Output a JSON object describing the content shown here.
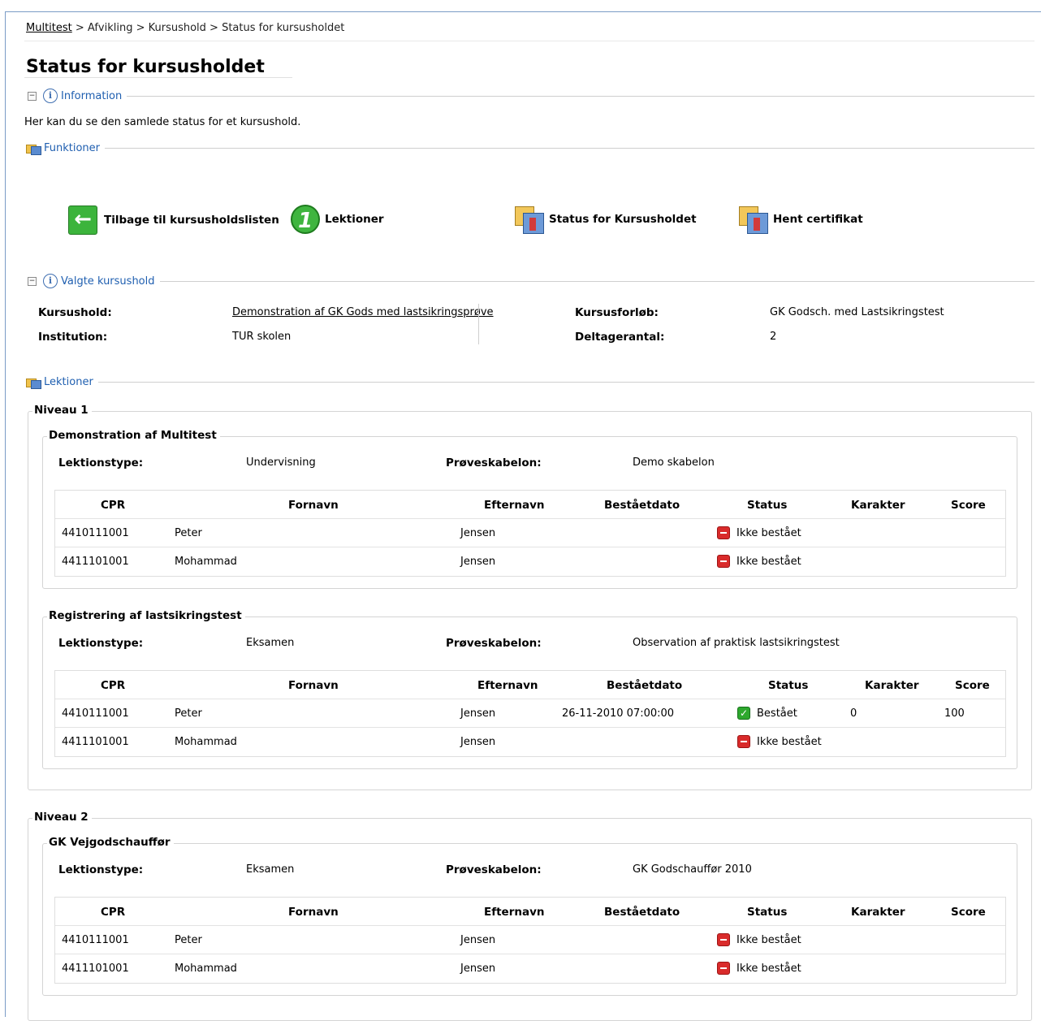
{
  "breadcrumb": {
    "root": "Multitest",
    "path": " > Afvikling > Kursushold > Status for kursusholdet"
  },
  "page_title": "Status for kursusholdet",
  "sections": {
    "information": "Information",
    "functions": "Funktioner",
    "selected": "Valgte kursushold",
    "lessons": "Lektioner"
  },
  "description": "Her kan du se den samlede status for et kursushold.",
  "functions": {
    "back": "Tilbage til kursusholdslisten",
    "lessons": "Lektioner",
    "status": "Status for Kursusholdet",
    "certificate": "Hent certifikat"
  },
  "selected": {
    "kursushold_label": "Kursushold:",
    "kursushold_value": "Demonstration af GK Gods med lastsikringsprøve",
    "institution_label": "Institution:",
    "institution_value": "TUR skolen",
    "forloeb_label": "Kursusforløb:",
    "forloeb_value": "GK Godsch. med Lastsikringstest",
    "deltager_label": "Deltagerantal:",
    "deltager_value": "2"
  },
  "labels": {
    "type": "Lektionstype:",
    "template": "Prøveskabelon:"
  },
  "columns": [
    "CPR",
    "Fornavn",
    "Efternavn",
    "Beståetdato",
    "Status",
    "Karakter",
    "Score"
  ],
  "levels": [
    {
      "name": "Niveau 1",
      "lessons": [
        {
          "name": "Demonstration af Multitest",
          "type": "Undervisning",
          "template": "Demo skabelon",
          "rows": [
            {
              "cpr": "4410111001",
              "first": "Peter",
              "last": "Jensen",
              "date": "",
              "status": "Ikke bestået",
              "grade": "",
              "score": ""
            },
            {
              "cpr": "4411101001",
              "first": "Mohammad",
              "last": "Jensen",
              "date": "",
              "status": "Ikke bestået",
              "grade": "",
              "score": ""
            }
          ]
        },
        {
          "name": "Registrering af lastsikringstest",
          "type": "Eksamen",
          "template": "Observation af praktisk lastsikringstest",
          "rows": [
            {
              "cpr": "4410111001",
              "first": "Peter",
              "last": "Jensen",
              "date": "26-11-2010 07:00:00",
              "status": "Bestået",
              "grade": "0",
              "score": "100"
            },
            {
              "cpr": "4411101001",
              "first": "Mohammad",
              "last": "Jensen",
              "date": "",
              "status": "Ikke bestået",
              "grade": "",
              "score": ""
            }
          ]
        }
      ]
    },
    {
      "name": "Niveau 2",
      "lessons": [
        {
          "name": "GK Vejgodschauffør",
          "type": "Eksamen",
          "template": "GK Godschauffør 2010",
          "rows": [
            {
              "cpr": "4410111001",
              "first": "Peter",
              "last": "Jensen",
              "date": "",
              "status": "Ikke bestået",
              "grade": "",
              "score": ""
            },
            {
              "cpr": "4411101001",
              "first": "Mohammad",
              "last": "Jensen",
              "date": "",
              "status": "Ikke bestået",
              "grade": "",
              "score": ""
            }
          ]
        }
      ]
    }
  ],
  "colors": {
    "link": "#1f5fb0",
    "fail": "#d92b2b",
    "pass": "#2ea82e"
  }
}
